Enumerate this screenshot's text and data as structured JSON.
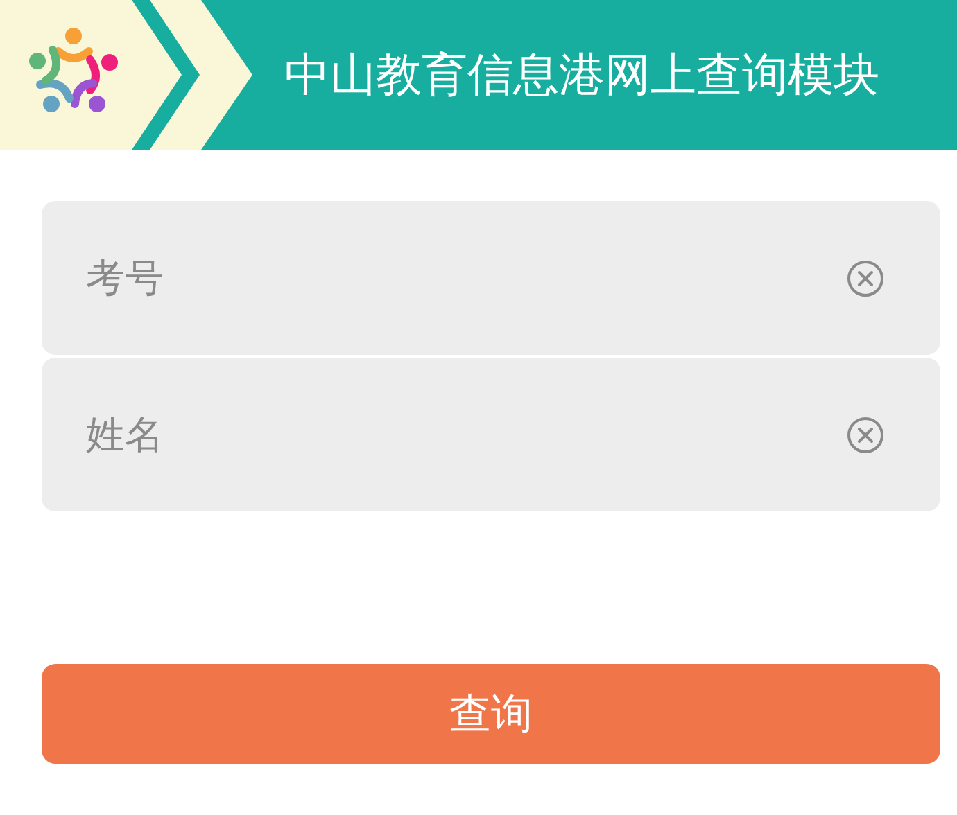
{
  "header": {
    "title": "中山教育信息港网上查询模块"
  },
  "fields": [
    {
      "placeholder": "考号"
    },
    {
      "placeholder": "姓名"
    }
  ],
  "submit_button": {
    "label": "查询"
  }
}
